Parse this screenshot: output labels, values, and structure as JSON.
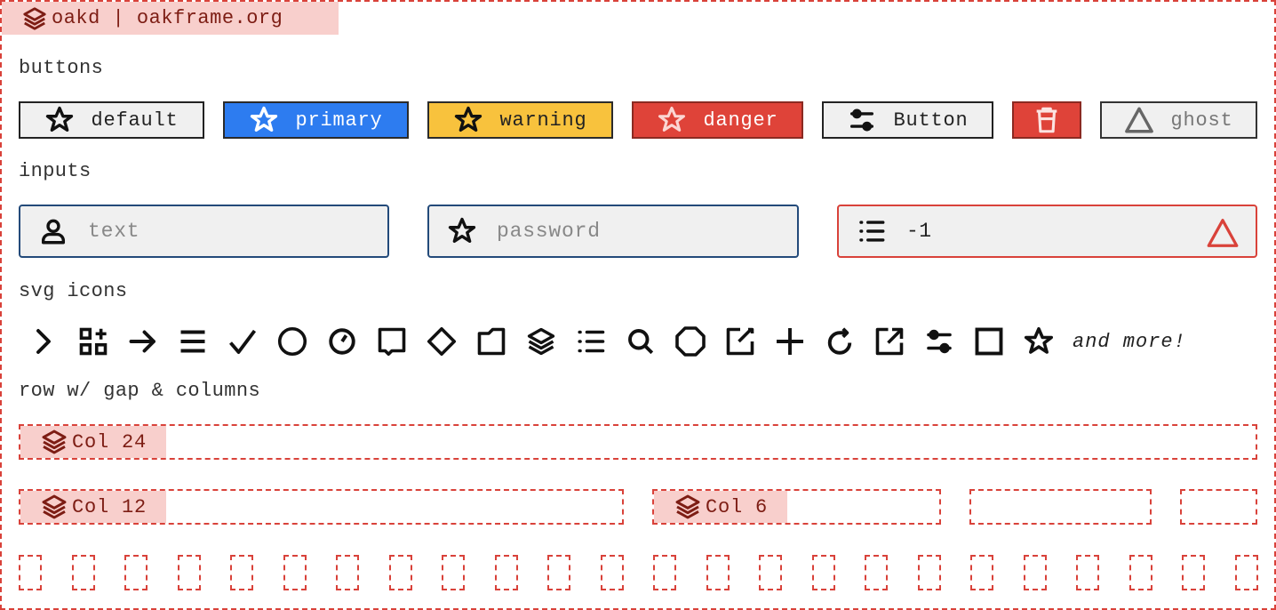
{
  "header": {
    "title": "oakd | oakframe.org"
  },
  "sections": {
    "buttons": "buttons",
    "inputs": "inputs",
    "icons": "svg icons",
    "grid": "row w/ gap & columns"
  },
  "buttons": [
    {
      "label": "default",
      "variant": "default",
      "icon": "star-icon"
    },
    {
      "label": "primary",
      "variant": "primary",
      "icon": "star-icon",
      "color": "#2d7cf0"
    },
    {
      "label": "warning",
      "variant": "warning",
      "icon": "star-icon",
      "color": "#f8c23d"
    },
    {
      "label": "danger",
      "variant": "danger",
      "icon": "star-icon",
      "color": "#df4339"
    },
    {
      "label": "Button",
      "variant": "default",
      "icon": "sliders-icon"
    },
    {
      "label": "",
      "variant": "danger",
      "icon": "trash-icon"
    },
    {
      "label": "ghost",
      "variant": "ghost",
      "icon": "triangle-icon"
    }
  ],
  "inputs": {
    "text": {
      "placeholder": "text",
      "icon": "user-icon"
    },
    "password": {
      "placeholder": "password",
      "icon": "star-icon"
    },
    "number": {
      "value": "-1",
      "icon": "list-icon",
      "status_icon": "warning-triangle-icon",
      "state": "error"
    }
  },
  "icons": {
    "items": [
      "chevron-right-icon",
      "apps-add-icon",
      "arrow-right-icon",
      "menu-icon",
      "check-icon",
      "circle-icon",
      "clock-icon",
      "comment-icon",
      "diamond-icon",
      "folder-icon",
      "layers-icon",
      "list-icon",
      "search-icon",
      "octagon-icon",
      "edit-icon",
      "plus-icon",
      "refresh-icon",
      "external-link-icon",
      "sliders-icon",
      "square-icon",
      "star-icon"
    ],
    "more_label": "and more!"
  },
  "grid": {
    "col24": "Col 24",
    "col12": "Col 12",
    "col6": "Col 6"
  },
  "colors": {
    "accent_red": "#d9423a",
    "tag_bg": "#f8cfcc",
    "tag_text": "#7d1d14",
    "primary": "#2d7cf0",
    "warning": "#f8c23d",
    "danger": "#df4339",
    "input_border": "#234a7a"
  }
}
